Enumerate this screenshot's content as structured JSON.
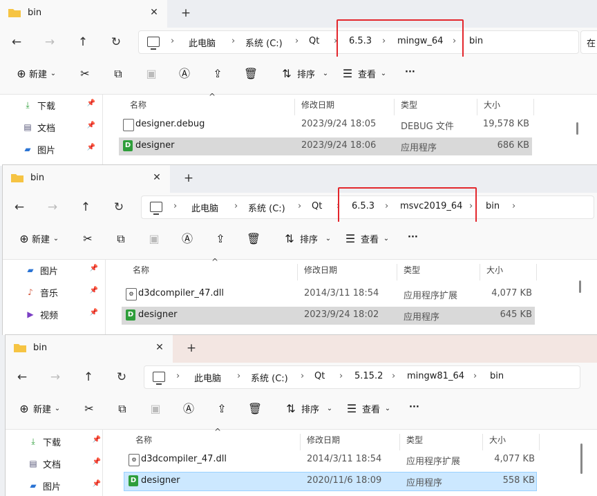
{
  "windows": [
    {
      "tab_title": "bin",
      "breadcrumbs": [
        "此电脑",
        "系统 (C:)",
        "Qt",
        "6.5.3",
        "mingw_64",
        "bin"
      ],
      "search_text": "在",
      "toolbar": {
        "new": "新建",
        "sort": "排序",
        "view": "查看",
        "more": "···"
      },
      "columns": [
        "名称",
        "修改日期",
        "类型",
        "大小"
      ],
      "sidebar": [
        {
          "label": "下载",
          "icon": "download-icon"
        },
        {
          "label": "文档",
          "icon": "document-icon"
        },
        {
          "label": "图片",
          "icon": "picture-icon"
        }
      ],
      "files": [
        {
          "name": "designer.debug",
          "date": "2023/9/24 18:05",
          "type": "DEBUG 文件",
          "size": "19,578 KB",
          "icon": "file-icon"
        },
        {
          "name": "designer",
          "date": "2023/9/24 18:06",
          "type": "应用程序",
          "size": "686 KB",
          "icon": "exe-icon"
        }
      ]
    },
    {
      "tab_title": "bin",
      "breadcrumbs": [
        "此电脑",
        "系统 (C:)",
        "Qt",
        "6.5.3",
        "msvc2019_64",
        "bin"
      ],
      "toolbar": {
        "new": "新建",
        "sort": "排序",
        "view": "查看",
        "more": "···"
      },
      "columns": [
        "名称",
        "修改日期",
        "类型",
        "大小"
      ],
      "sidebar": [
        {
          "label": "图片",
          "icon": "picture-icon"
        },
        {
          "label": "音乐",
          "icon": "music-icon"
        },
        {
          "label": "视频",
          "icon": "video-icon"
        }
      ],
      "files": [
        {
          "name": "d3dcompiler_47.dll",
          "date": "2014/3/11 18:54",
          "type": "应用程序扩展",
          "size": "4,077 KB",
          "icon": "dll-icon"
        },
        {
          "name": "designer",
          "date": "2023/9/24 18:02",
          "type": "应用程序",
          "size": "645 KB",
          "icon": "exe-icon"
        }
      ]
    },
    {
      "tab_title": "bin",
      "breadcrumbs": [
        "此电脑",
        "系统 (C:)",
        "Qt",
        "5.15.2",
        "mingw81_64",
        "bin"
      ],
      "toolbar": {
        "new": "新建",
        "sort": "排序",
        "view": "查看",
        "more": "···"
      },
      "columns": [
        "名称",
        "修改日期",
        "类型",
        "大小"
      ],
      "sidebar": [
        {
          "label": "下载",
          "icon": "download-icon"
        },
        {
          "label": "文档",
          "icon": "document-icon"
        },
        {
          "label": "图片",
          "icon": "picture-icon"
        }
      ],
      "files": [
        {
          "name": "d3dcompiler_47.dll",
          "date": "2014/3/11 18:54",
          "type": "应用程序扩展",
          "size": "4,077 KB",
          "icon": "dll-icon"
        },
        {
          "name": "designer",
          "date": "2020/11/6 18:09",
          "type": "应用程序",
          "size": "558 KB",
          "icon": "exe-icon"
        }
      ]
    }
  ],
  "colors": {
    "highlight_box": "#e3262c",
    "folder": "#f6c443",
    "exe": "#2e9e3a"
  }
}
